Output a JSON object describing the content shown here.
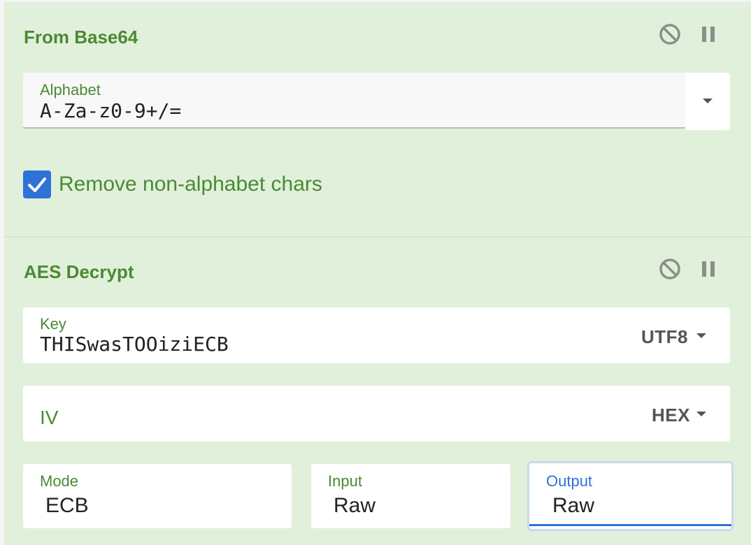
{
  "from_base64": {
    "title": "From Base64",
    "alphabet": {
      "label": "Alphabet",
      "value": "A-Za-z0-9+/="
    },
    "remove_non_alphabet": {
      "label": "Remove non-alphabet chars",
      "checked": true
    }
  },
  "aes_decrypt": {
    "title": "AES Decrypt",
    "key": {
      "label": "Key",
      "value": "THISwasTOOiziECB",
      "encoding": "UTF8"
    },
    "iv": {
      "label": "IV",
      "value": "",
      "encoding": "HEX"
    },
    "mode": {
      "label": "Mode",
      "value": "ECB"
    },
    "input": {
      "label": "Input",
      "value": "Raw"
    },
    "output": {
      "label": "Output",
      "value": "Raw"
    }
  },
  "icons": {
    "disable": "disable-icon",
    "pause": "pause-icon",
    "check": "check-icon",
    "dropdown": "caret-down-icon"
  },
  "colors": {
    "panel_bg": "#e1f0db",
    "accent_green": "#4a8a33",
    "accent_blue": "#2f72d6"
  }
}
